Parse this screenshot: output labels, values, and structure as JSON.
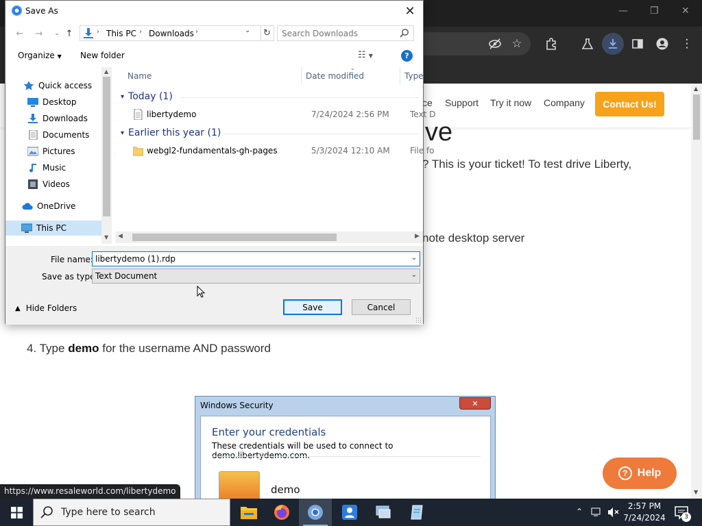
{
  "browser": {
    "window_controls": [
      "—",
      "❐",
      "✕"
    ],
    "toolbar_icons": [
      "eye-slash-icon",
      "star-icon",
      "extensions-icon",
      "flask-icon",
      "download-icon",
      "sidepanel-icon",
      "profile-icon",
      "menu-icon"
    ]
  },
  "website": {
    "nav": [
      "ce",
      "Support",
      "Try it now",
      "Company"
    ],
    "contact_label": "Contact Us!",
    "heading_fragment": "ve",
    "line1": "? This is your ticket! To test drive Liberty,",
    "line2": "note desktop server",
    "step4_prefix": "4. Type ",
    "step4_bold": "demo",
    "step4_suffix": " for the username AND password",
    "help_label": "Help",
    "windows_security": {
      "title": "Windows Security",
      "close": "✕",
      "heading": "Enter your credentials",
      "subtitle": "These credentials will be used to connect to demo.libertydemo.com.",
      "username": "demo"
    }
  },
  "status_url": "https://www.resaleworld.com/libertydemo",
  "dialog": {
    "title": "Save As",
    "breadcrumb": [
      "This PC",
      "Downloads"
    ],
    "search_placeholder": "Search Downloads",
    "organize_label": "Organize",
    "new_folder_label": "New folder",
    "nav_items": [
      {
        "label": "Quick access",
        "icon": "star-icon",
        "pinned": false
      },
      {
        "label": "Desktop",
        "icon": "desktop-icon",
        "pinned": true
      },
      {
        "label": "Downloads",
        "icon": "downloads-icon",
        "pinned": true
      },
      {
        "label": "Documents",
        "icon": "documents-icon",
        "pinned": true
      },
      {
        "label": "Pictures",
        "icon": "pictures-icon",
        "pinned": true
      },
      {
        "label": "Music",
        "icon": "music-icon",
        "pinned": false
      },
      {
        "label": "Videos",
        "icon": "videos-icon",
        "pinned": false
      },
      {
        "label": "OneDrive",
        "icon": "cloud-icon",
        "pinned": false
      },
      {
        "label": "This PC",
        "icon": "computer-icon",
        "pinned": false,
        "selected": true
      }
    ],
    "columns": [
      "Name",
      "Date modified",
      "Type"
    ],
    "groups": [
      {
        "label": "Today (1)",
        "files": [
          {
            "name": "libertydemo",
            "date": "7/24/2024 2:56 PM",
            "type": "Text D",
            "icon": "text-file-icon"
          }
        ]
      },
      {
        "label": "Earlier this year (1)",
        "files": [
          {
            "name": "webgl2-fundamentals-gh-pages",
            "date": "5/3/2024 12:10 AM",
            "type": "File fo",
            "icon": "folder-icon"
          }
        ]
      }
    ],
    "file_name_label": "File name:",
    "file_name_value": "libertydemo (1).rdp",
    "save_type_label": "Save as type:",
    "save_type_value": "Text Document",
    "hide_folders_label": "Hide Folders",
    "save_label": "Save",
    "cancel_label": "Cancel"
  },
  "taskbar": {
    "search_placeholder": "Type here to search",
    "apps": [
      "file-explorer-icon",
      "firefox-icon",
      "chrome-icon",
      "app-blue-icon",
      "remote-desktop-icon",
      "notepad-icon"
    ],
    "time": "2:57 PM",
    "date": "7/24/2024",
    "notification_count": "3"
  },
  "colors": {
    "accent": "#0078d7",
    "contact_button": "#f7a21b",
    "help_button": "#ee7a3b",
    "group_heading": "#1e3287"
  }
}
